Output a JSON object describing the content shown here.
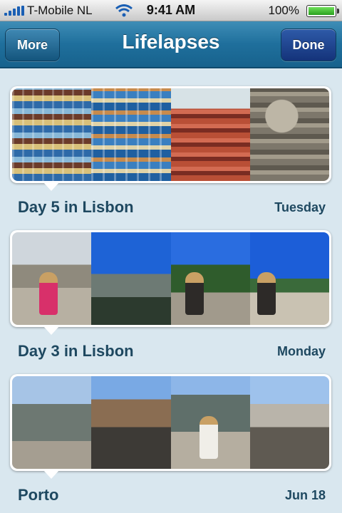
{
  "status_bar": {
    "carrier": "T-Mobile NL",
    "time": "9:41 AM",
    "battery": "100%",
    "battery_level": 1.0
  },
  "nav": {
    "left_button": "More",
    "title": "Lifelapses",
    "right_button": "Done"
  },
  "lapses": [
    {
      "title": "Day 5 in Lisbon",
      "day": "Tuesday"
    },
    {
      "title": "Day 3 in Lisbon",
      "day": "Monday"
    },
    {
      "title": "Porto",
      "day": "Jun 18"
    }
  ],
  "colors": {
    "nav_blue": "#1f6f9c",
    "background": "#d9e7ef",
    "label_text": "#1e4860"
  }
}
